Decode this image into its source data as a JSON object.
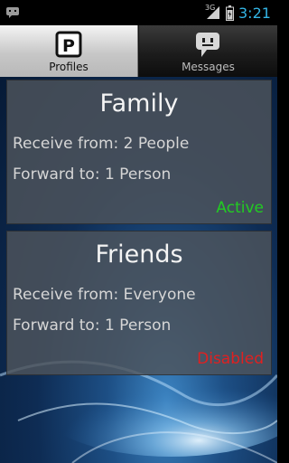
{
  "status_bar": {
    "network": "3G",
    "time": "3:21",
    "time_color": "#33b5e5"
  },
  "tabs": [
    {
      "label": "Profiles",
      "icon": "profiles-p-icon",
      "selected": true
    },
    {
      "label": "Messages",
      "icon": "messages-chat-icon",
      "selected": false
    }
  ],
  "profiles": [
    {
      "name": "Family",
      "receive": "Receive from: 2 People",
      "forward": "Forward to: 1 Person",
      "status": "Active",
      "status_color": "#22cc22"
    },
    {
      "name": "Friends",
      "receive": "Receive from: Everyone",
      "forward": "Forward to: 1 Person",
      "status": "Disabled",
      "status_color": "#e02020"
    }
  ]
}
